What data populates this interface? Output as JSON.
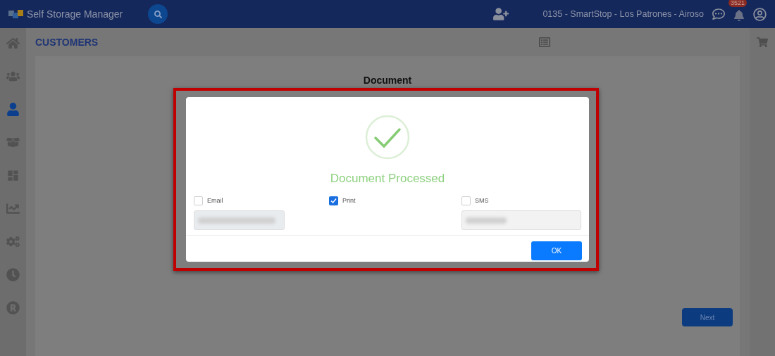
{
  "header": {
    "app_name": "Self Storage Manager",
    "location": "0135 - SmartStop - Los Patrones - Airoso",
    "notification_count": "3521"
  },
  "sidebar": {
    "items": [
      {
        "kind": "home",
        "selected": false
      },
      {
        "kind": "users",
        "selected": false
      },
      {
        "kind": "user",
        "selected": true
      },
      {
        "kind": "box",
        "selected": false
      },
      {
        "kind": "dashboard",
        "selected": false
      },
      {
        "kind": "chart",
        "selected": false
      },
      {
        "kind": "cogs",
        "selected": false
      },
      {
        "kind": "clock",
        "selected": false
      },
      {
        "kind": "registered",
        "selected": false
      }
    ]
  },
  "page_title": "CUSTOMERS",
  "document_heading": "Document",
  "dialog": {
    "message": "Document Processed",
    "options": [
      {
        "label": "Email",
        "checked": false,
        "field": true
      },
      {
        "label": "Print",
        "checked": true,
        "field": false
      },
      {
        "label": "SMS",
        "checked": false,
        "field": true
      }
    ],
    "ok_button": "OK"
  },
  "next_button": "Next"
}
